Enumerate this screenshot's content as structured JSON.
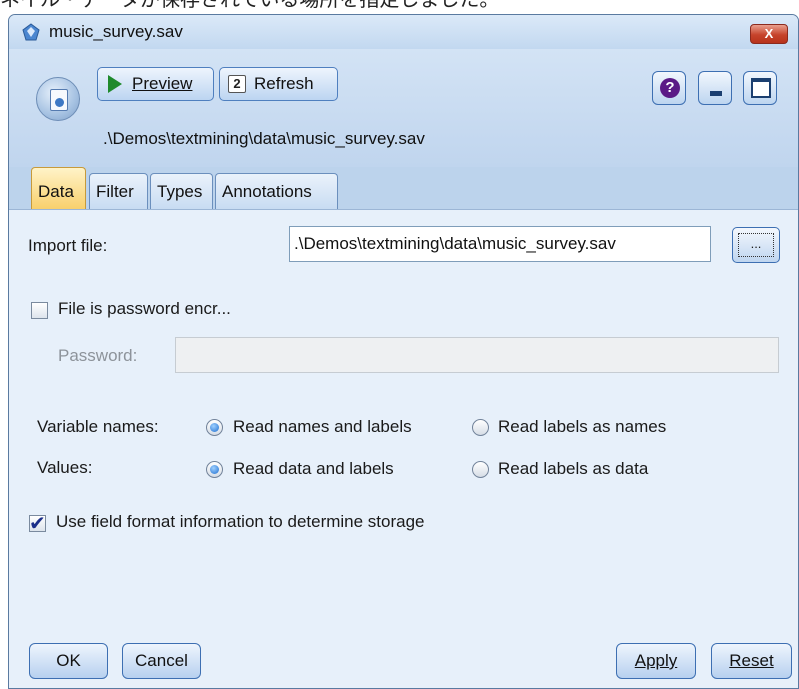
{
  "top_text": "ネイル・データが保存されている場所を指定しました。",
  "window": {
    "title": "music_survey.sav",
    "close_label": "X",
    "icon": "spss-node-icon"
  },
  "toolbar": {
    "preview_label": "Preview",
    "refresh_label": "Refresh",
    "help_label": "?"
  },
  "header": {
    "file_path": ".\\Demos\\textmining\\data\\music_survey.sav"
  },
  "tabs": [
    "Data",
    "Filter",
    "Types",
    "Annotations"
  ],
  "form": {
    "import_file_label": "Import file:",
    "import_file_value": ".\\Demos\\textmining\\data\\music_survey.sav",
    "browse_label": "...",
    "password_checkbox_label": "File is password encr...",
    "password_checked": false,
    "password_label": "Password:",
    "password_value": "",
    "variable_names_label": "Variable names:",
    "variable_names_options": [
      "Read names and labels",
      "Read labels as names"
    ],
    "variable_names_selected": "Read names and labels",
    "values_label": "Values:",
    "values_options": [
      "Read data and labels",
      "Read labels as data"
    ],
    "values_selected": "Read data and labels",
    "field_format_label": "Use field format information to determine storage",
    "field_format_checked": true
  },
  "buttons": {
    "ok": "OK",
    "cancel": "Cancel",
    "apply": "Apply",
    "reset": "Reset"
  },
  "colors": {
    "window_bg": "#bcd3ec",
    "panel_bg": "#e7f0fa",
    "active_tab": "#f8cf6a",
    "close_button": "#c6432b"
  }
}
